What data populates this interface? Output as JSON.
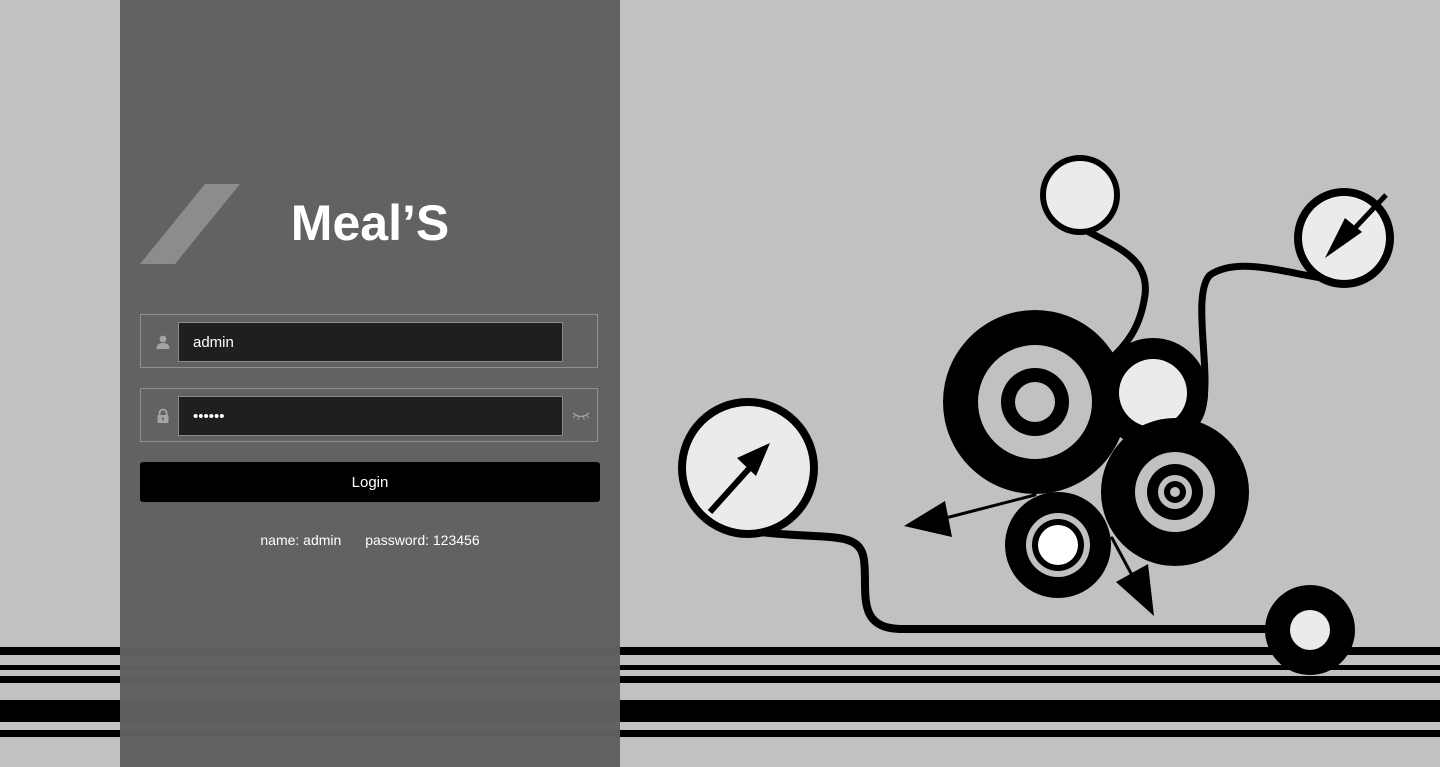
{
  "login": {
    "title": "Meal’S",
    "username": {
      "value": "admin",
      "icon": "user-icon"
    },
    "password": {
      "value": "123456",
      "icon": "lock-icon",
      "toggle_icon": "eye-closed-icon"
    },
    "submit_label": "Login",
    "hint": {
      "name": "name: admin",
      "password": "password: 123456"
    }
  },
  "theme": {
    "background": "#c1c1c1",
    "panel": "#606060",
    "input_bg": "#1f1f1f",
    "button_bg": "#000000",
    "logo_slash": "#8c8c8c",
    "art_fill": "#000000",
    "art_light": "#ebebeb"
  }
}
